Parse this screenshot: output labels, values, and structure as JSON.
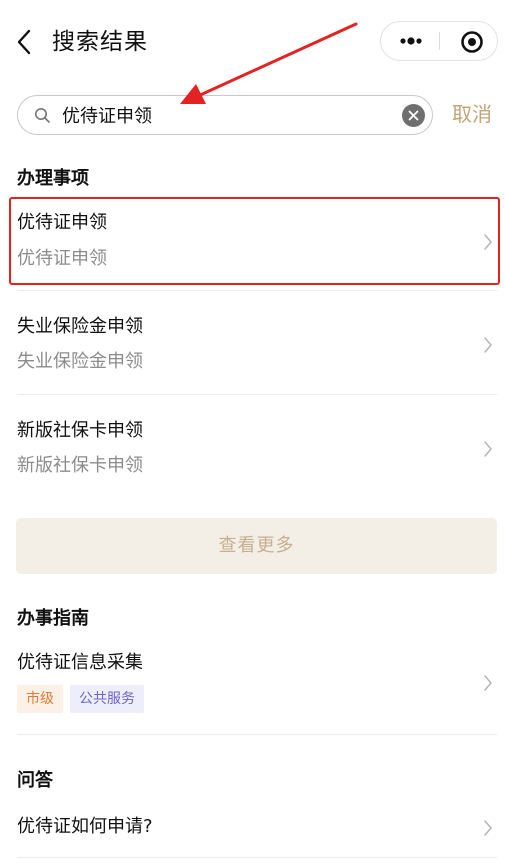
{
  "header": {
    "title": "搜索结果"
  },
  "search": {
    "query": "优待证申领",
    "placeholder": "",
    "cancel_label": "取消"
  },
  "matters": {
    "title": "办理事项",
    "items": [
      {
        "title": "优待证申领",
        "subtitle": "优待证申领"
      },
      {
        "title": "失业保险金申领",
        "subtitle": "失业保险金申领"
      },
      {
        "title": "新版社保卡申领",
        "subtitle": "新版社保卡申领"
      }
    ],
    "more_label": "查看更多"
  },
  "guide": {
    "title": "办事指南",
    "items": [
      {
        "title": "优待证信息采集",
        "tags": [
          "市级",
          "公共服务"
        ]
      }
    ]
  },
  "qa": {
    "title": "问答",
    "items": [
      {
        "title": "优待证如何申请?"
      }
    ]
  },
  "colors": {
    "accent": "#c0a47a",
    "highlight": "#e32222",
    "tag_city_text": "#e07b35",
    "tag_city_bg": "#fdf1e7",
    "tag_service_text": "#6f63c8",
    "tag_service_bg": "#eeeefb"
  }
}
